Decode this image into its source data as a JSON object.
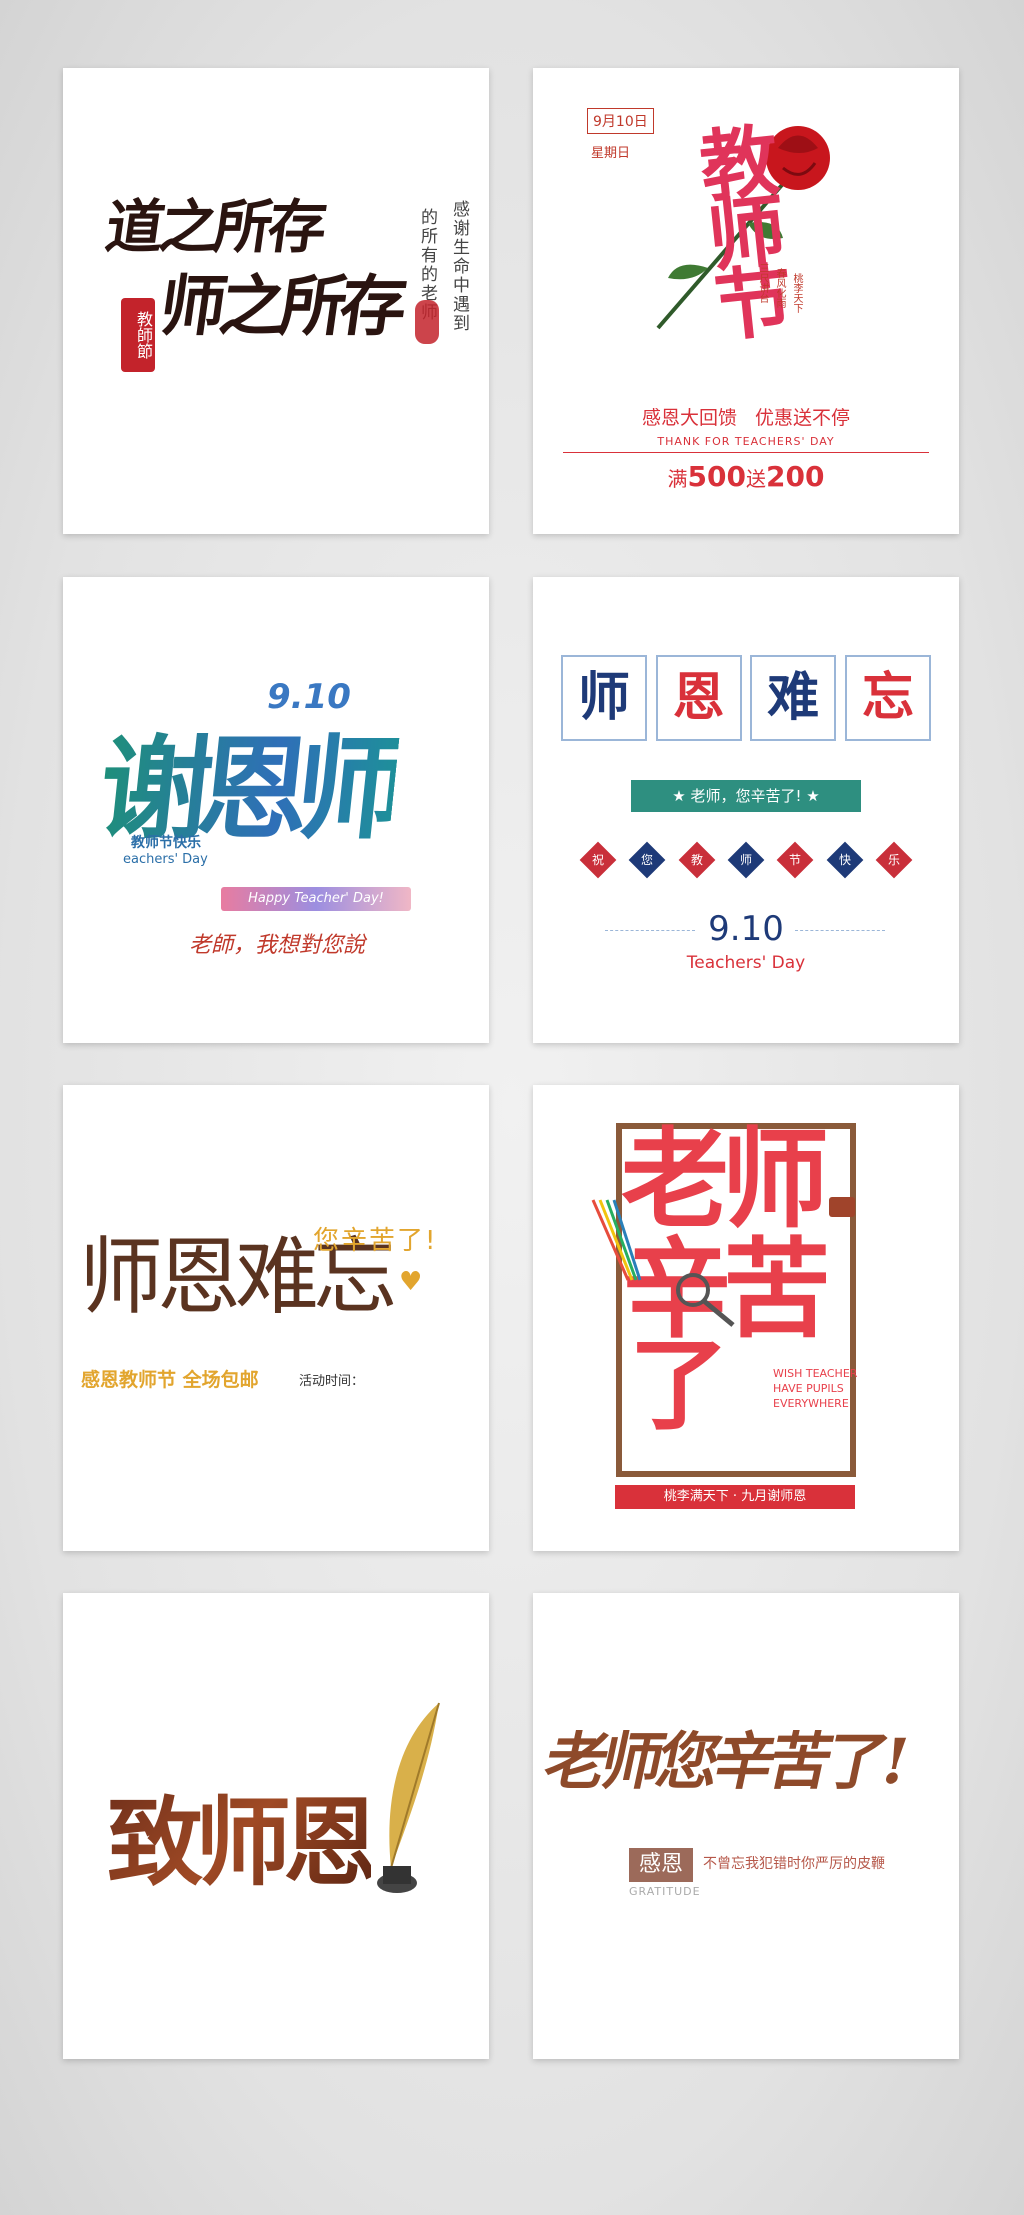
{
  "cards": {
    "c1": {
      "line1": "道之所存",
      "line2": "师之所存",
      "seal": "教師節",
      "vert1": "感谢生命中遇到",
      "vert2": "的所有的老师"
    },
    "c2": {
      "date": "9月10日",
      "weekday": "星期日",
      "title": "教师节",
      "small_vert1": "三尺讲台",
      "small_vert2": "春风化雨",
      "small_vert3": "桃李天下",
      "promo": "感恩大回馈   优惠送不停",
      "english": "THANK FOR TEACHERS' DAY",
      "offer_prefix": "满",
      "offer_a": "500",
      "offer_mid": "送",
      "offer_b": "200"
    },
    "c3": {
      "date": "9.10",
      "title": "谢恩师",
      "sub_cn": "教师节快乐",
      "sub_en": "eachers' Day",
      "banner": "Happy Teacher' Day!",
      "note": "老師，我想對您說"
    },
    "c4": {
      "boxes": [
        "师",
        "恩",
        "难",
        "忘"
      ],
      "ribbon": "★ 老师，您辛苦了! ★",
      "diamonds": [
        "祝",
        "您",
        "教",
        "师",
        "节",
        "快",
        "乐"
      ],
      "date": "9.10",
      "english": "Teachers' Day"
    },
    "c5": {
      "title": "师恩难忘",
      "side": "您辛苦了!",
      "promo": "感恩教师节 全场包邮",
      "time_label": "活动时间："
    },
    "c6": {
      "line1": "老师",
      "line2": "辛苦",
      "line3": "了",
      "english1": "WISH TEACHER",
      "english2": "HAVE PUPILS",
      "english3": "EVERYWHERE",
      "banner": "桃李满天下 · 九月谢师恩"
    },
    "c7": {
      "title": "致师恩"
    },
    "c8": {
      "title": "老师您辛苦了!",
      "badge": "感恩",
      "badge_en": "GRATITUDE",
      "line": "不曾忘我犯错时你严厉的皮鞭"
    }
  },
  "colors": {
    "brown": "#5a3320",
    "red": "#d9313a",
    "navy": "#1e3a78",
    "teal": "#2b7f8a",
    "gold": "#e2a52e"
  }
}
